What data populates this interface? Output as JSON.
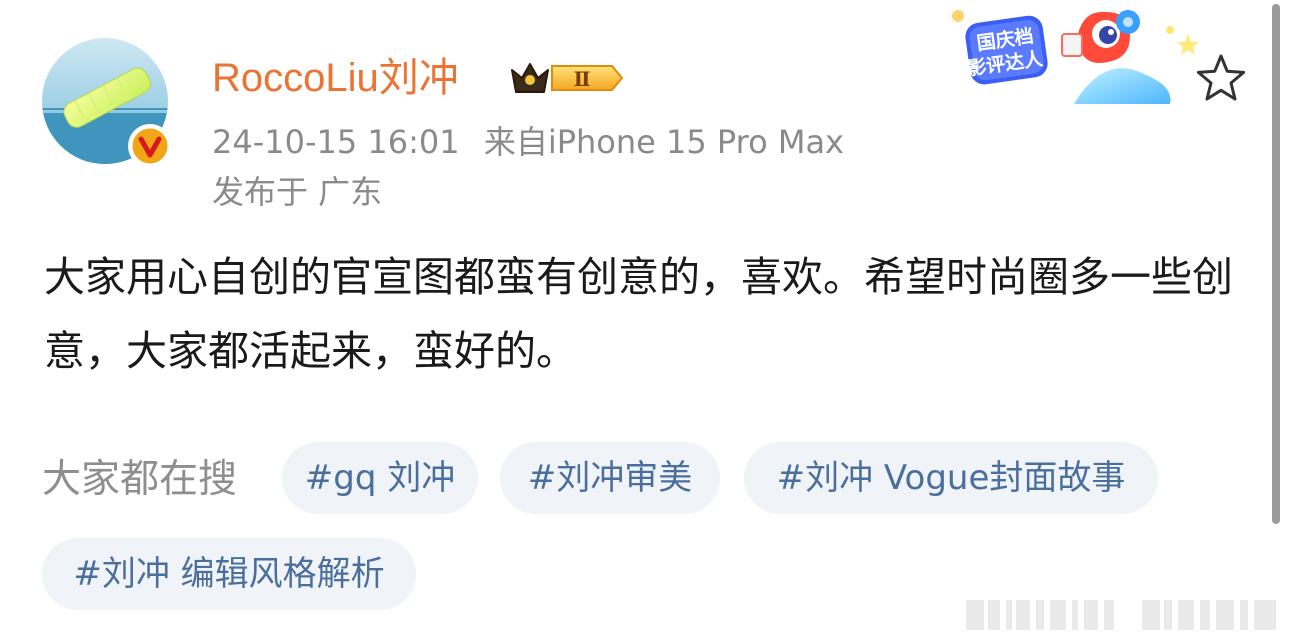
{
  "post": {
    "username": "RoccoLiu刘冲",
    "timestamp": "24-10-15 16:01",
    "source": "来自iPhone 15 Pro Max",
    "location": "发布于 广东",
    "text": "大家用心自创的官宣图都蛮有创意的，喜欢。希望时尚圈多一些创意，大家都活起来，蛮好的。",
    "level_badge": "Ⅱ",
    "event_badge": {
      "line1": "国庆档",
      "line2": "影评达人"
    }
  },
  "search": {
    "label": "大家都在搜",
    "tags": [
      {
        "text": "#gq 刘冲"
      },
      {
        "text": "#刘冲审美"
      },
      {
        "text": "#刘冲 Vogue封面故事"
      },
      {
        "text": "#刘冲 编辑风格解析"
      }
    ]
  },
  "colors": {
    "username": "#eb7334",
    "meta": "#8a8a8a",
    "body_text": "#1a1a1a",
    "chip_bg": "#f0f3f8",
    "chip_text": "#4a6f9c",
    "verified_badge": "#e8a012"
  },
  "icons": {
    "verified": "verified-v-icon",
    "level": "crown-level-icon",
    "favorite": "star-outline-icon"
  }
}
